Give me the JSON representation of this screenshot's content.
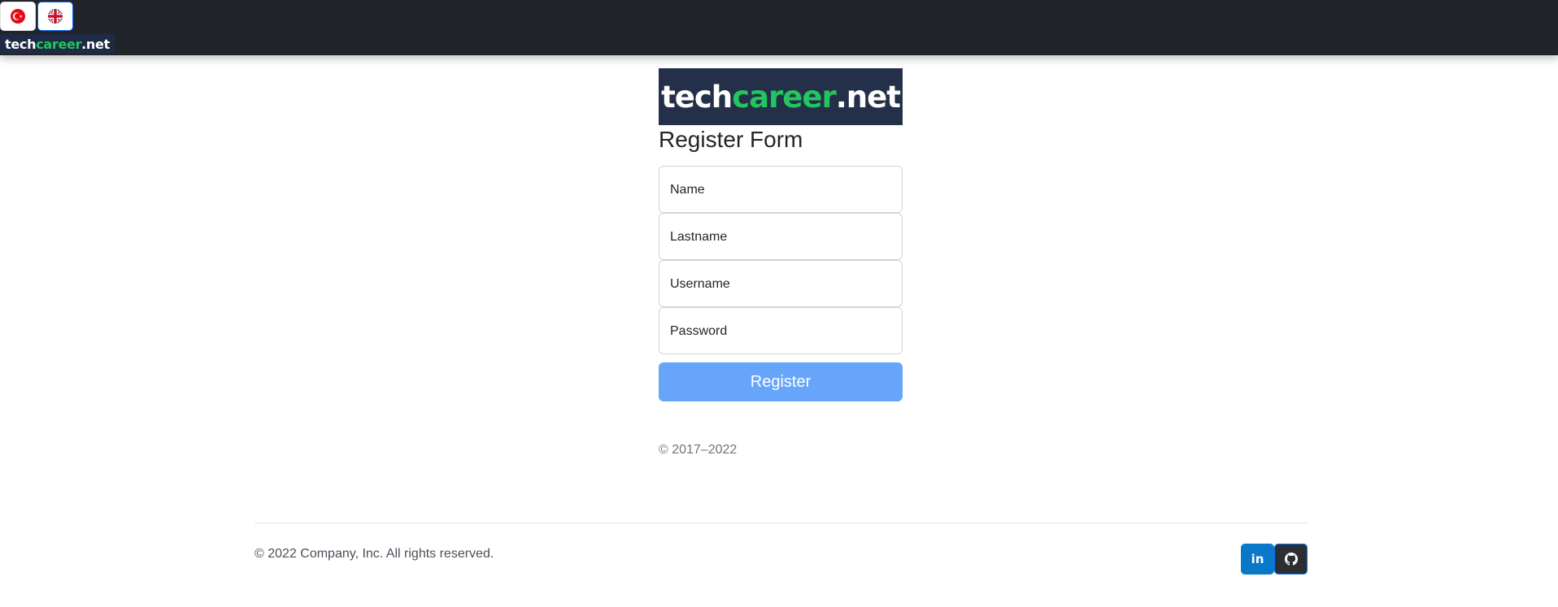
{
  "navbar": {
    "lang_tr_icon": "turkey-flag-icon",
    "lang_en_icon": "uk-flag-icon",
    "brand": {
      "part1": "tech",
      "part2": "career",
      "part3": ".net"
    }
  },
  "logo": {
    "part1": "tech",
    "part2": "career",
    "part3": ".net"
  },
  "form": {
    "title": "Register Form",
    "name_placeholder": "Name",
    "lastname_placeholder": "Lastname",
    "username_placeholder": "Username",
    "password_placeholder": "Password",
    "submit_label": "Register",
    "copyright": "© 2017–2022"
  },
  "footer": {
    "text": "© 2022 Company, Inc. All rights reserved.",
    "linkedin_label": "in",
    "linkedin_icon": "linkedin-icon",
    "github_icon": "github-icon"
  },
  "colors": {
    "navbar_bg": "#212529",
    "brand_green": "#22c55e",
    "logo_bg": "#243049",
    "button_primary": "#67a5fa",
    "linkedin_blue": "#0a78c8"
  }
}
